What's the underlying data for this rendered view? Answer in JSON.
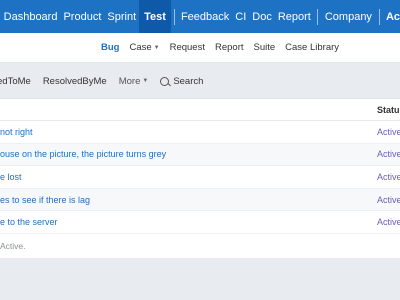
{
  "topnav": {
    "items": [
      "Dashboard",
      "Product",
      "Sprint",
      "Test",
      "Feedback",
      "CI",
      "Doc",
      "Report"
    ],
    "active": "Test",
    "company": "Company",
    "cutoff": "Ac"
  },
  "subnav": {
    "items": [
      {
        "label": "Bug",
        "active": true,
        "dropdown": false
      },
      {
        "label": "Case",
        "active": false,
        "dropdown": true
      },
      {
        "label": "Request",
        "active": false,
        "dropdown": false
      },
      {
        "label": "Report",
        "active": false,
        "dropdown": false
      },
      {
        "label": "Suite",
        "active": false,
        "dropdown": false
      },
      {
        "label": "Case Library",
        "active": false,
        "dropdown": false
      }
    ]
  },
  "filters": {
    "assigned_partial": "edToMe",
    "resolved": "ResolvedByMe",
    "more": "More",
    "search": "Search"
  },
  "table": {
    "status_header": "Status",
    "rows": [
      {
        "title": "not right",
        "status": "Active"
      },
      {
        "title": "ouse on the picture, the picture turns grey",
        "status": "Active"
      },
      {
        "title": "e lost",
        "status": "Active"
      },
      {
        "title": "es to see if there is lag",
        "status": "Active"
      },
      {
        "title": "e to the server",
        "status": "Active"
      }
    ],
    "footer": "Active."
  },
  "colors": {
    "brand": "#1e72c4",
    "link": "#1e6fbf",
    "status_active": "#6b5fb5"
  }
}
